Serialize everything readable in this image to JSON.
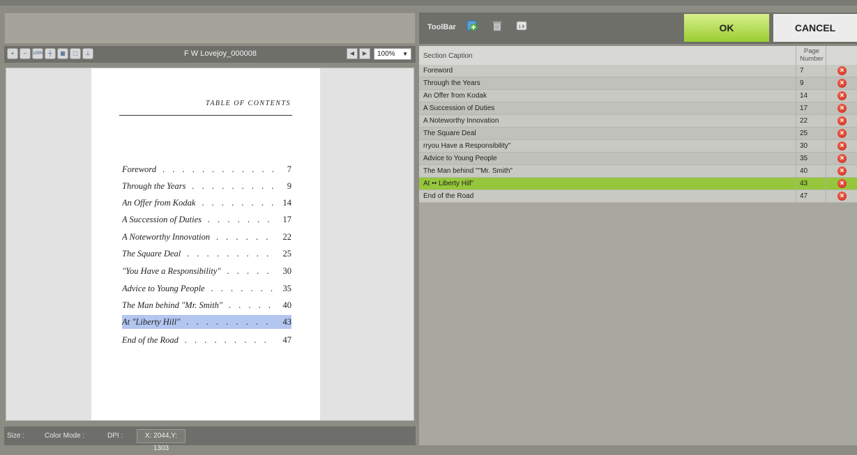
{
  "viewer": {
    "document_title": "F W Lovejoy_000008",
    "zoom": "100%",
    "toolbar_icons": [
      "zoom-in-icon",
      "zoom-out-icon",
      "actual-size-icon",
      "fit-width-icon",
      "grid-icon",
      "select-icon",
      "stamp-icon"
    ],
    "page": {
      "heading": "TABLE OF CONTENTS",
      "entries": [
        {
          "title": "Foreword",
          "page": "7"
        },
        {
          "title": "Through the Years",
          "page": "9"
        },
        {
          "title": "An Offer from Kodak",
          "page": "14"
        },
        {
          "title": "A Succession of Duties",
          "page": "17"
        },
        {
          "title": "A Noteworthy Innovation",
          "page": "22"
        },
        {
          "title": "The Square Deal",
          "page": "25"
        },
        {
          "title": "\"You Have a Responsibility\"",
          "page": "30"
        },
        {
          "title": "Advice to Young People",
          "page": "35"
        },
        {
          "title": "The Man behind \"Mr. Smith\"",
          "page": "40"
        },
        {
          "title": "At \"Liberty Hill\"",
          "page": "43"
        },
        {
          "title": "End of the Road",
          "page": "47"
        }
      ],
      "highlight_color": "#b3c6f0"
    },
    "status": {
      "size_label": "Size :",
      "color_mode_label": "Color Mode :",
      "dpi_label": "DPI :",
      "coordinates": "X: 2044,Y: 1303"
    }
  },
  "toolbar": {
    "label": "ToolBar",
    "icons": [
      "add-image-icon",
      "trash-icon",
      "page-number-icon"
    ],
    "ok_label": "OK",
    "cancel_label": "CANCEL",
    "ok_color": "#9acd32"
  },
  "grid": {
    "columns": {
      "caption": "Section Caption",
      "page": "Page Number"
    },
    "rows": [
      {
        "caption": "Foreword",
        "page": "7"
      },
      {
        "caption": "Through the Years",
        "page": "9"
      },
      {
        "caption": "An Offer from Kodak",
        "page": "14"
      },
      {
        "caption": "A Succession of Duties",
        "page": "17"
      },
      {
        "caption": "A Noteworthy Innovation",
        "page": "22"
      },
      {
        "caption": "The Square Deal",
        "page": "25"
      },
      {
        "caption": "rryou Have a Responsibility\"",
        "page": "30"
      },
      {
        "caption": "Advice to Young People",
        "page": "35"
      },
      {
        "caption": "The Man behind \"\"Mr. Smith\"",
        "page": "40"
      },
      {
        "caption": "At •• Liberty Hill\"",
        "page": "43",
        "selected": true
      },
      {
        "caption": "End of the Road",
        "page": "47"
      }
    ],
    "selected_color": "#96c63c",
    "delete_icon": "delete-icon"
  }
}
